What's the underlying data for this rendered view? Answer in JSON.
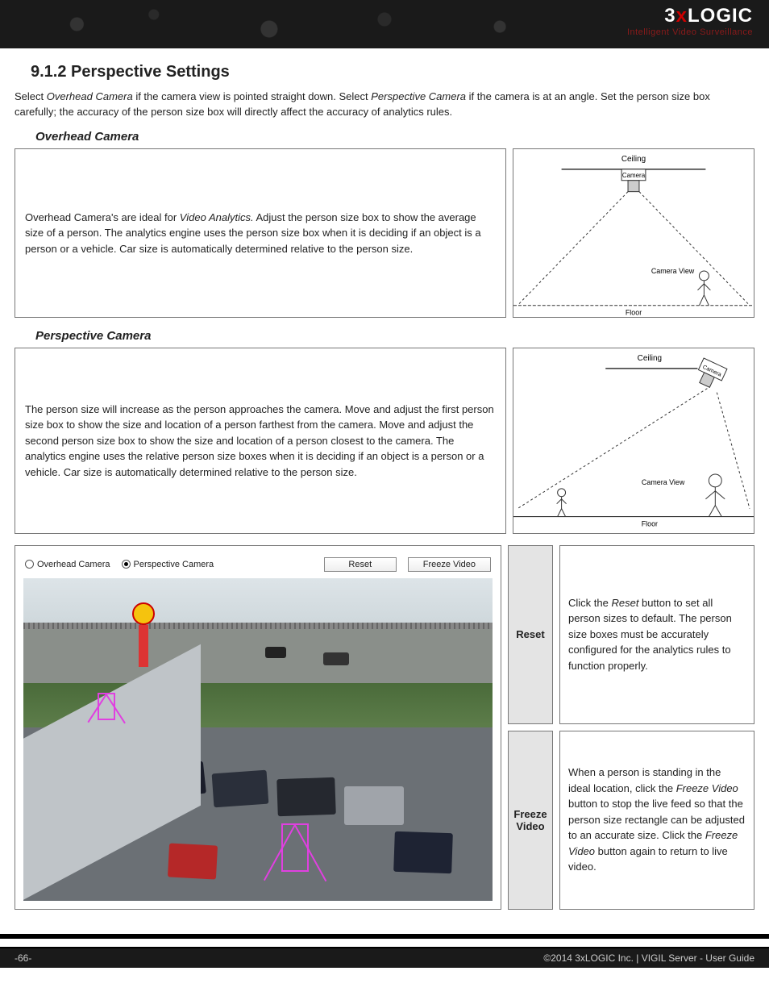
{
  "logo": {
    "brand_pre": "3",
    "brand_x": "x",
    "brand_post": "LOGIC",
    "tagline": "Intelligent Video Surveillance"
  },
  "section": {
    "number_title": "9.1.2 Perspective Settings",
    "intro_pre": "Select ",
    "intro_em1": "Overhead Camera",
    "intro_mid1": " if the camera view is pointed straight down. Select ",
    "intro_em2": "Perspective Camera",
    "intro_mid2": " if the camera is at an angle. Set the person size box carefully; the accuracy of the person size box will directly affect the accuracy of analytics rules."
  },
  "overhead": {
    "heading": "Overhead Camera",
    "text_pre": "Overhead Camera's are ideal for ",
    "text_em": "Video Analytics.",
    "text_post": "  Adjust the person size box to show the average size of a person. The analytics engine uses the person size box when it is deciding if an object is a person or a vehicle. Car size is automatically determined relative to the person size.",
    "diag": {
      "ceiling": "Ceiling",
      "camera": "Camera",
      "view": "Camera View",
      "floor": "Floor"
    }
  },
  "perspective": {
    "heading": "Perspective Camera",
    "text": "The person size will increase as the person approaches the camera. Move and adjust the first person size box to show the size and location of a person farthest from the camera. Move and adjust the second person size box to show the size and location of a person closest to the camera. The analytics engine uses the relative person size boxes when it is deciding if an object is a person or a vehicle.  Car size is automatically determined relative to the person size.",
    "diag": {
      "ceiling": "Ceiling",
      "camera": "Camera",
      "view": "Camera View",
      "floor": "Floor"
    }
  },
  "toolbar": {
    "radio_overhead": "Overhead Camera",
    "radio_perspective": "Perspective Camera",
    "reset": "Reset",
    "freeze": "Freeze Video"
  },
  "reset_block": {
    "label": "Reset",
    "desc_pre": "Click the ",
    "desc_em": "Reset",
    "desc_post": " button to set all person sizes to default. The person size boxes must be accurately configured for the analytics rules to function properly."
  },
  "freeze_block": {
    "label": "Freeze Video",
    "desc_pre": "When a person is standing in the ideal location, click the ",
    "desc_em1": "Freeze Video",
    "desc_mid": " button to stop the live feed so that the person size rectangle can be adjusted to an accurate size. Click the ",
    "desc_em2": "Freeze Video",
    "desc_post": " button again to return to live video."
  },
  "footer": {
    "page": "-66-",
    "copyright": "©2014 3xLOGIC Inc. | VIGIL Server - User Guide"
  }
}
